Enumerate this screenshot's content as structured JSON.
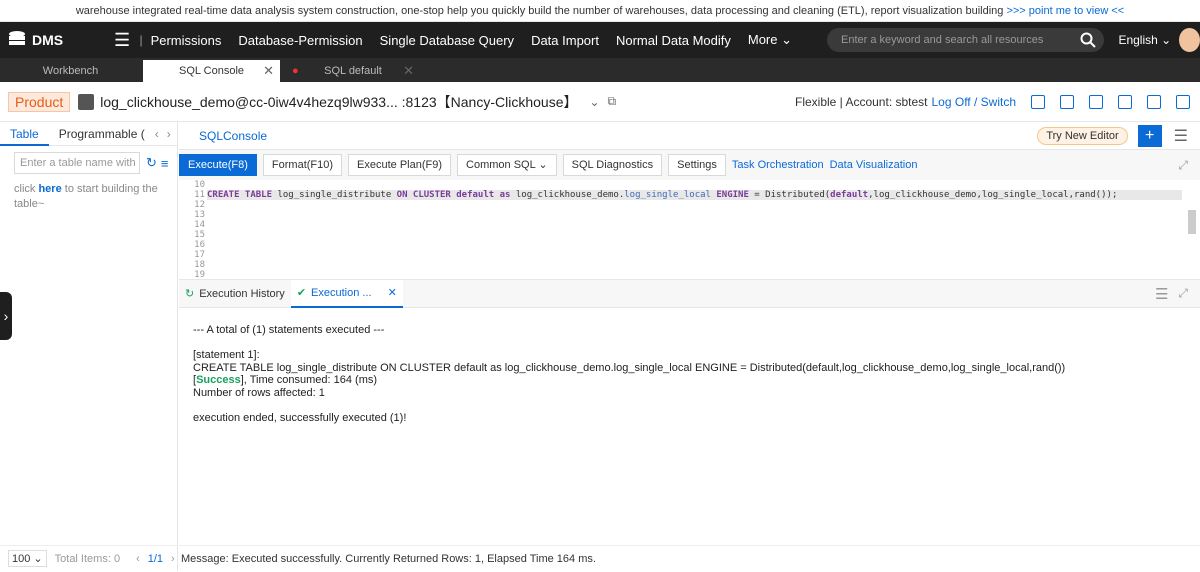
{
  "banner": {
    "text": "warehouse integrated real-time data analysis system construction, one-stop help you quickly build the number of warehouses, data processing and cleaning (ETL), report visualization building",
    "link": ">>> point me to view <<"
  },
  "topnav": {
    "brand": "DMS",
    "items": [
      "Permissions",
      "Database-Permission",
      "Single Database Query",
      "Data Import",
      "Normal Data Modify",
      "More"
    ],
    "search_placeholder": "Enter a keyword and search all resources",
    "language": "English"
  },
  "tabs": [
    {
      "label": "Workbench"
    },
    {
      "label": "SQL Console"
    },
    {
      "label": "SQL default"
    }
  ],
  "dbbar": {
    "product": "Product",
    "dbname": "log_clickhouse_demo@cc-0iw4v4hezq9lw933... :8123【Nancy-Clickhouse】",
    "mode": "Flexible | Account: sbtest",
    "logoff": "Log Off / Switch"
  },
  "left": {
    "tab_table": "Table",
    "tab_prog": "Programmable (",
    "input_placeholder": "Enter a table name with %",
    "hint_pre": "click",
    "hint_here": "here",
    "hint_post": "to start building the table~",
    "page_size": "100",
    "total": "Total Items: 0",
    "page": "1/1"
  },
  "main": {
    "console_tab": "SQLConsole",
    "try_new": "Try New Editor",
    "plus": "+"
  },
  "toolbar": {
    "execute": "Execute(F8)",
    "format": "Format(F10)",
    "plan": "Execute Plan(F9)",
    "common": "Common SQL",
    "diag": "SQL Diagnostics",
    "settings": "Settings",
    "orchestration": "Task Orchestration",
    "visualization": "Data Visualization"
  },
  "editor": {
    "lines": [
      "10",
      "11",
      "12",
      "13",
      "14",
      "15",
      "16",
      "17",
      "18",
      "19"
    ]
  },
  "results": {
    "history": "Execution History",
    "exec": "Execution ...",
    "summary": "--- A total of (1) statements executed ---",
    "stmt": "[statement 1]:",
    "sql": "CREATE TABLE log_single_distribute ON CLUSTER default as log_clickhouse_demo.log_single_local ENGINE = Distributed(default,log_clickhouse_demo,log_single_local,rand())",
    "success": "Success",
    "time": ", Time consumed: 164 (ms)",
    "rows": "Number of rows affected: 1",
    "ended": "execution ended, successfully executed (1)!"
  },
  "message": "Message: Executed successfully. Currently Returned Rows: 1, Elapsed Time 164 ms."
}
